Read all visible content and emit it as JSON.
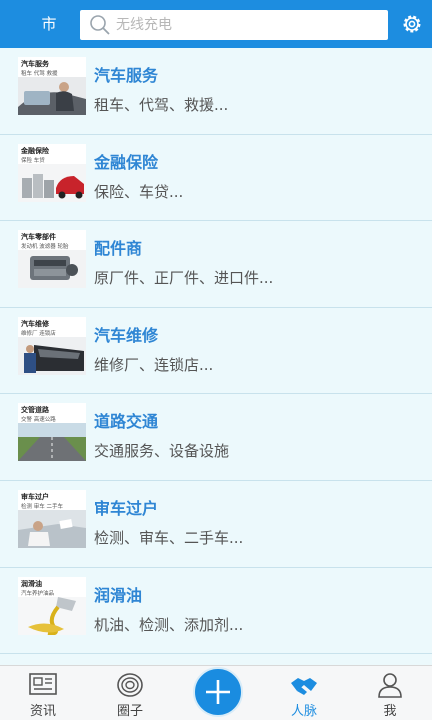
{
  "header": {
    "city_label": "市",
    "search_placeholder": "无线充电"
  },
  "categories": [
    {
      "title": "汽车服务",
      "desc": "租车、代驾、救援...",
      "thumb_title": "汽车服务",
      "thumb_sub": "租车  代驾  救援"
    },
    {
      "title": "金融保险",
      "desc": "保险、车贷...",
      "thumb_title": "金融保险",
      "thumb_sub": "保险  车贷"
    },
    {
      "title": "配件商",
      "desc": "原厂件、正厂件、进口件...",
      "thumb_title": "汽车零部件",
      "thumb_sub": "发动机  波滤器  轮胎"
    },
    {
      "title": "汽车维修",
      "desc": "维修厂、连锁店...",
      "thumb_title": "汽车维修",
      "thumb_sub": "维修厂  连锁店"
    },
    {
      "title": "道路交通",
      "desc": "交通服务、设备设施",
      "thumb_title": "交管道路",
      "thumb_sub": "交警  高速公路"
    },
    {
      "title": "审车过户",
      "desc": "检测、审车、二手车...",
      "thumb_title": "审车过户",
      "thumb_sub": "检测  审车  二手车"
    },
    {
      "title": "润滑油",
      "desc": "机油、检测、添加剂...",
      "thumb_title": "润滑油",
      "thumb_sub": "汽车养护油品"
    }
  ],
  "tabbar": {
    "tabs": [
      {
        "label": "资讯",
        "icon": "news-icon"
      },
      {
        "label": "圈子",
        "icon": "circle-icon"
      },
      {
        "label": "人脉",
        "icon": "handshake-icon"
      },
      {
        "label": "我",
        "icon": "profile-icon"
      }
    ],
    "active_tab": "人脉",
    "add_icon": "plus-icon"
  },
  "colors": {
    "header": "#1d8de0",
    "accent": "#2f86d4",
    "background": "#ecf9fc"
  }
}
